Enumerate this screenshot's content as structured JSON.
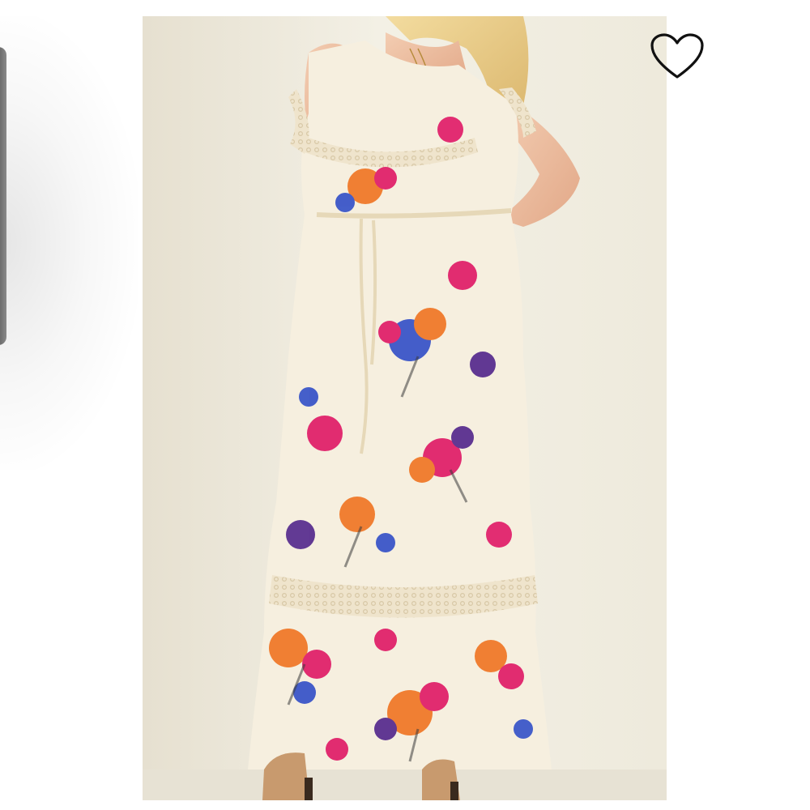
{
  "gallery": {
    "photo_subject": "floral-maxi-dress-photo",
    "favorite_icon": "heart-outline-icon",
    "favorited": false
  },
  "colors": {
    "background": "#ffffff",
    "photo_backdrop": "#f2efe3",
    "dress_base": "#f6efdf",
    "lace_trim": "#e9dcc2",
    "flower_magenta": "#e0226b",
    "flower_orange": "#f07a2a",
    "flower_blue": "#3b56c8",
    "flower_purple": "#5a2f8f",
    "heart_outline": "#111111"
  }
}
